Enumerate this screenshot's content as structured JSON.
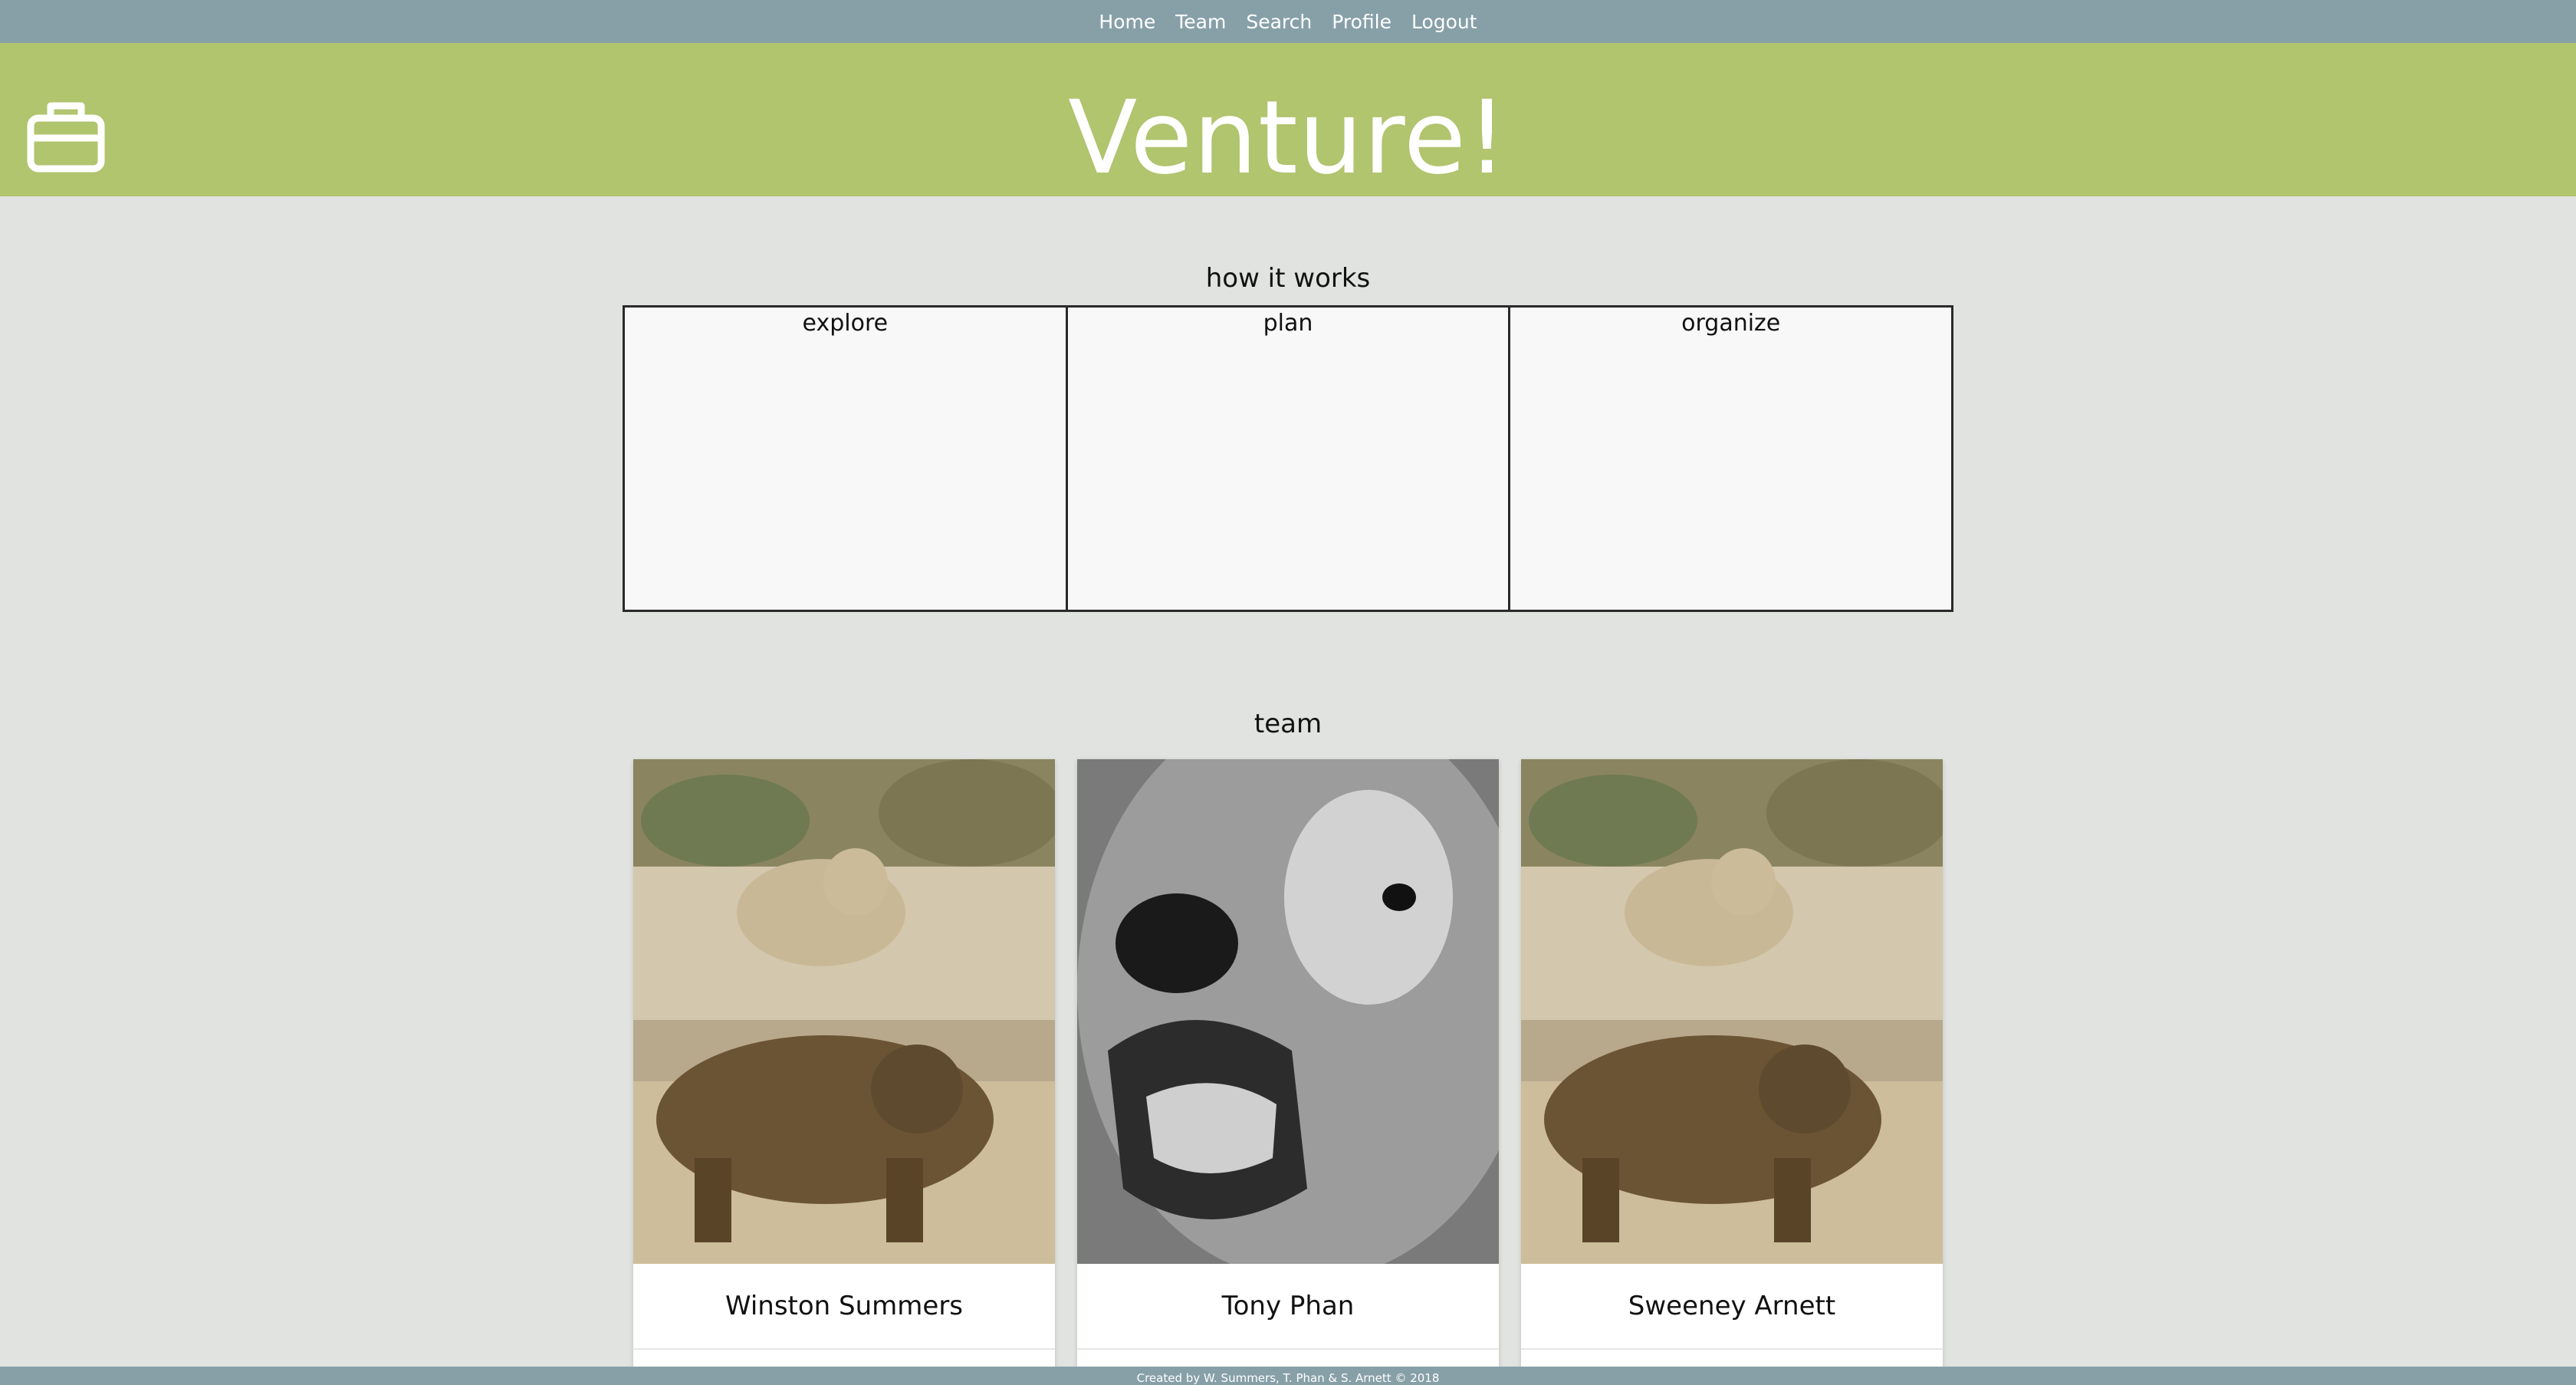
{
  "nav": {
    "items": [
      "Home",
      "Team",
      "Search",
      "Profile",
      "Logout"
    ]
  },
  "banner": {
    "title": "Venture!",
    "logo_icon": "briefcase-icon",
    "color": "#b1c46e"
  },
  "how": {
    "heading": "how it works",
    "cells": [
      "explore",
      "plan",
      "organize"
    ]
  },
  "team": {
    "heading": "team",
    "members": [
      {
        "name": "Winston Summers",
        "photo": "two-brown-bears-on-rocks"
      },
      {
        "name": "Tony Phan",
        "photo": "roaring-bear-closeup-grayscale"
      },
      {
        "name": "Sweeney Arnett",
        "photo": "two-brown-bears-on-rocks"
      }
    ]
  },
  "footer": {
    "text": "Created by W. Summers, T. Phan & S. Arnett © 2018"
  },
  "colors": {
    "nav": "#87a0a8",
    "background": "#e1e3e0"
  }
}
